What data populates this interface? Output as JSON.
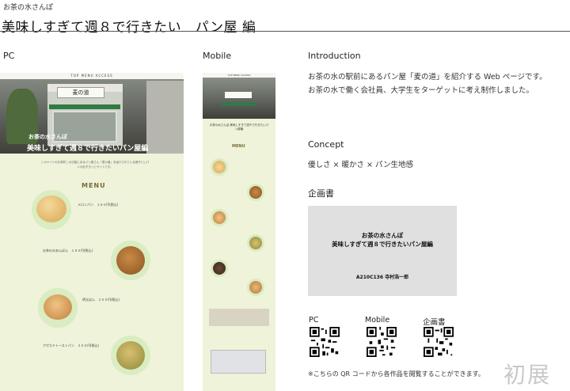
{
  "header": {
    "top_label": "お茶の水さんぽ",
    "title": "美味しすぎて週８で行きたい　パン屋 編"
  },
  "sections": {
    "pc": "PC",
    "mobile": "Mobile",
    "introduction": "Introduction",
    "concept": "Concept",
    "plan": "企画書"
  },
  "introduction": {
    "line1": "お茶の水の駅前にあるパン屋「麦の道」を紹介する Web ページです。",
    "line2": "お茶の水で働く会社員、大学生をターゲットに考え制作しました。"
  },
  "concept": {
    "text": "優しさ × 暖かさ × パン生地感"
  },
  "plan_box": {
    "title_line1": "お茶の水さんぽ",
    "title_line2": "美味しすぎて週８で行きたいパン屋編",
    "author": "A210C136 寺村浩一郎"
  },
  "pc_mock": {
    "nav": "TOP  MENU  ACCESS",
    "shop_sign": "麦の道",
    "hero_sub": "お茶の水さんぽ",
    "hero_title": "美味しすぎて週８で行きたいパン屋編",
    "intro": "ニルサイドのお茶町この辺接にあるパン屋さん「麦の道」を紹介されている様子といパンが必ずきっとサイトです。",
    "menu_heading": "MENU",
    "items": [
      {
        "name": "メロンパン　１６０円(税込)"
      },
      {
        "name": "お茶の水あんぱん　１８０円(税込)"
      },
      {
        "name": "明太ぱん　２００円(税込)"
      },
      {
        "name": "アボカドトーストパン　２００円(税込)"
      }
    ]
  },
  "mobile_mock": {
    "nav": "TOP  MENU  ACCESS",
    "hero_title": "お茶の水さんぽ 美味しすぎて週８で行きたいパン屋編",
    "menu_heading": "MENU"
  },
  "qr": {
    "pc_label": "PC",
    "mobile_label": "Mobile",
    "plan_label": "企画書"
  },
  "note": "※こちらの QR コードから各作品を閲覧することができます。",
  "logo": "初展"
}
